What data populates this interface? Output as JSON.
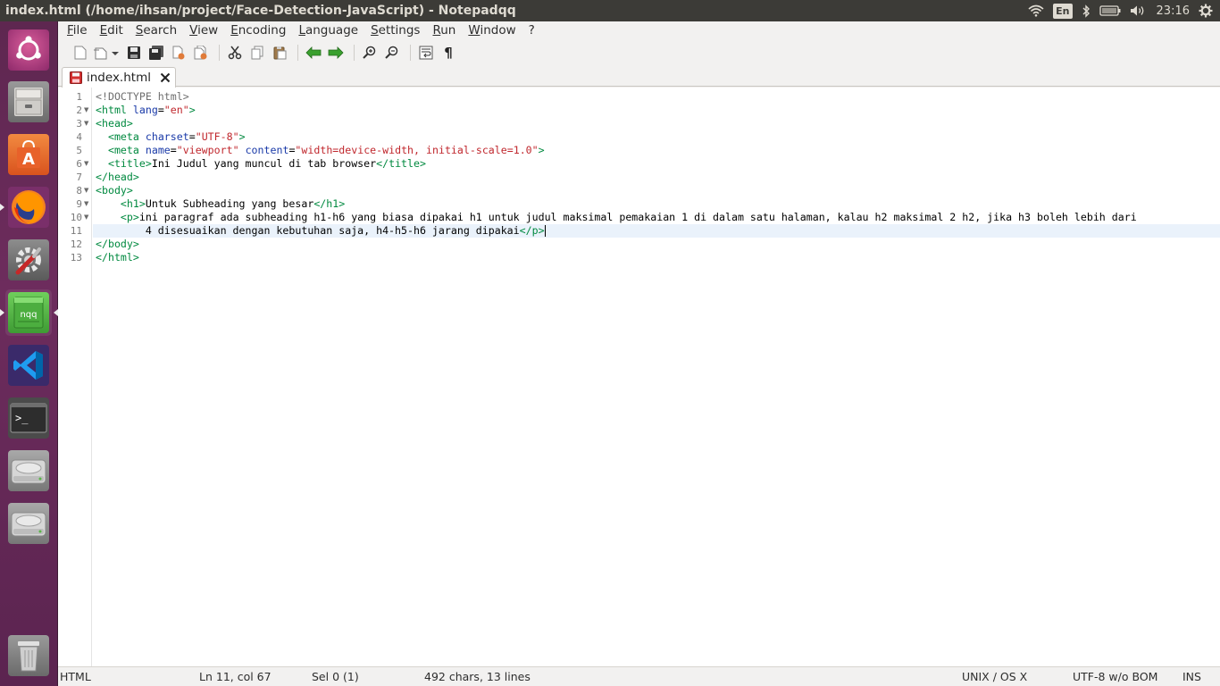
{
  "window": {
    "title": "index.html (/home/ihsan/project/Face-Detection-JavaScript) - Notepadqq"
  },
  "tray": {
    "keyboard": "En",
    "clock": "23:16"
  },
  "launcher": {
    "items": [
      {
        "name": "ubuntu-dash",
        "icon": "ubuntu-logo-icon"
      },
      {
        "name": "files",
        "icon": "file-cabinet-icon"
      },
      {
        "name": "software-center",
        "icon": "shopping-bag-icon"
      },
      {
        "name": "firefox",
        "icon": "firefox-icon"
      },
      {
        "name": "system-settings",
        "icon": "settings-wrench-icon"
      },
      {
        "name": "notepadqq",
        "icon": "notepadqq-icon",
        "label": "nqq"
      },
      {
        "name": "vscode",
        "icon": "vscode-icon"
      },
      {
        "name": "terminal",
        "icon": "terminal-icon",
        "label": ">_"
      },
      {
        "name": "drive-1",
        "icon": "hard-drive-icon"
      },
      {
        "name": "drive-2",
        "icon": "hard-drive-icon"
      },
      {
        "name": "trash",
        "icon": "trash-icon"
      }
    ]
  },
  "menubar": {
    "items": [
      "File",
      "Edit",
      "Search",
      "View",
      "Encoding",
      "Language",
      "Settings",
      "Run",
      "Window",
      "?"
    ]
  },
  "toolbar": {
    "buttons": [
      "new-file-icon",
      "open-file-icon",
      "save-icon",
      "save-all-icon",
      "close-icon",
      "close-all-icon",
      "cut-icon",
      "copy-icon",
      "paste-icon",
      "undo-icon",
      "redo-icon",
      "zoom-in-icon",
      "zoom-out-icon",
      "word-wrap-icon",
      "pilcrow-icon"
    ],
    "pilcrow": "¶"
  },
  "tabs": [
    {
      "label": "index.html",
      "modified": false,
      "active": true
    }
  ],
  "editor": {
    "line_numbers": [
      "1",
      "2",
      "3",
      "4",
      "5",
      "6",
      "7",
      "8",
      "9",
      "10",
      "11",
      "12",
      "13"
    ],
    "current_line": 11,
    "lines": [
      "<!DOCTYPE html>",
      "<html lang=\"en\">",
      "<head>",
      "  <meta charset=\"UTF-8\">",
      "  <meta name=\"viewport\" content=\"width=device-width, initial-scale=1.0\">",
      "  <title>Ini Judul yang muncul di tab browser</title>",
      "</head>",
      "<body>",
      "    <h1>Untuk Subheading yang besar</h1>",
      "    <p>ini paragraf ada subheading h1-h6 yang biasa dipakai h1 untuk judul maksimal pemakaian 1 di dalam satu halaman, kalau h2 maksimal 2 h2, jika h3 boleh lebih dari",
      "        4 disesuaikan dengan kebutuhan saja, h4-h5-h6 jarang dipakai</p>",
      "</body>",
      "</html>"
    ]
  },
  "statusbar": {
    "language": "HTML",
    "position": "Ln 11, col 67",
    "selection": "Sel 0 (1)",
    "stats": "492 chars, 13 lines",
    "eol": "UNIX / OS X",
    "encoding": "UTF-8 w/o BOM",
    "mode": "INS"
  },
  "colors": {
    "panel": "#3c3b37",
    "launcher": "#5e2750",
    "tag": "#00893f",
    "attribute": "#1a3aa8",
    "string": "#c0272d",
    "current_line": "#eaf2fb"
  }
}
